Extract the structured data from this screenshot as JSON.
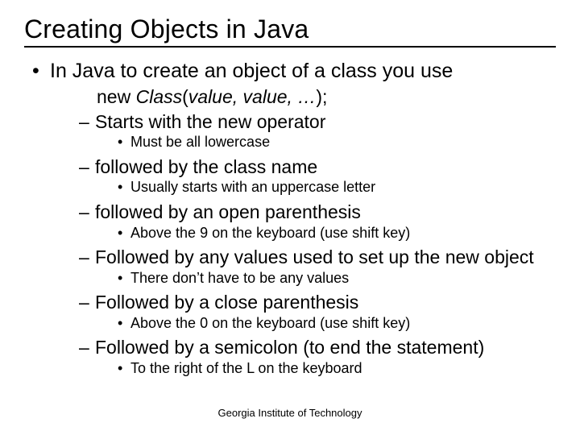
{
  "title": "Creating Objects in Java",
  "main_bullet": "In Java to create an object of a class you use",
  "code_new": "new ",
  "code_class": "Class",
  "code_open": "(",
  "code_args": "value, value, …",
  "code_close": ");",
  "sub": {
    "s1": "Starts with the new operator",
    "s1d": "Must be all lowercase",
    "s2": "followed by the class name",
    "s2d": "Usually starts with an uppercase letter",
    "s3": "followed by an open parenthesis",
    "s3d": "Above the 9 on the keyboard (use shift key)",
    "s4": "Followed by any values used to set up the new object",
    "s4d": "There don’t have to be any values",
    "s5": "Followed by a close parenthesis",
    "s5d": "Above the 0 on the keyboard (use shift key)",
    "s6": "Followed by a semicolon (to end the statement)",
    "s6d": "To the right of the L on the keyboard"
  },
  "footer": "Georgia Institute of Technology"
}
